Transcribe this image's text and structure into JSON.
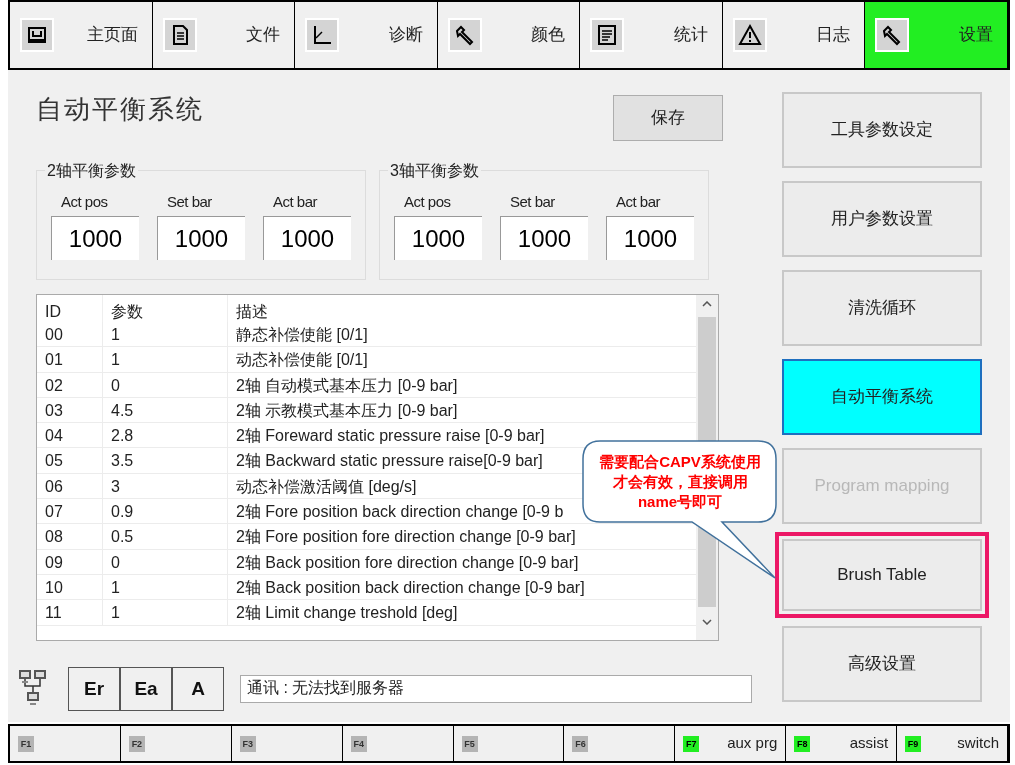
{
  "tabs": [
    {
      "label": "主页面",
      "selected": false
    },
    {
      "label": "文件",
      "selected": false
    },
    {
      "label": "诊断",
      "selected": false
    },
    {
      "label": "颜色",
      "selected": false
    },
    {
      "label": "统计",
      "selected": false
    },
    {
      "label": "日志",
      "selected": false
    },
    {
      "label": "设置",
      "selected": true
    }
  ],
  "page_title": "自动平衡系统",
  "save_button": "保存",
  "groups": [
    {
      "title": "2轴平衡参数",
      "fields": [
        {
          "label": "Act pos",
          "value": "1000"
        },
        {
          "label": "Set bar",
          "value": "1000"
        },
        {
          "label": "Act bar",
          "value": "1000"
        }
      ]
    },
    {
      "title": "3轴平衡参数",
      "fields": [
        {
          "label": "Act pos",
          "value": "1000"
        },
        {
          "label": "Set bar",
          "value": "1000"
        },
        {
          "label": "Act bar",
          "value": "1000"
        }
      ]
    }
  ],
  "table": {
    "columns": [
      "ID",
      "参数",
      "描述"
    ],
    "rows": [
      [
        "00",
        "1",
        "静态补偿使能 [0/1]"
      ],
      [
        "01",
        "1",
        "动态补偿使能 [0/1]"
      ],
      [
        "02",
        "0",
        "2轴 自动模式基本压力 [0-9 bar]"
      ],
      [
        "03",
        "4.5",
        "2轴 示教模式基本压力 [0-9 bar]"
      ],
      [
        "04",
        "2.8",
        "2轴 Foreward static pressure raise [0-9 bar]"
      ],
      [
        "05",
        "3.5",
        "2轴 Backward static pressure raise[0-9 bar]"
      ],
      [
        "06",
        "3",
        "动态补偿激活阈值 [deg/s]"
      ],
      [
        "07",
        "0.9",
        "2轴 Fore position back direction change [0-9 b"
      ],
      [
        "08",
        "0.5",
        "2轴 Fore position fore direction change [0-9 bar]"
      ],
      [
        "09",
        "0",
        "2轴 Back position fore direction change [0-9 bar]"
      ],
      [
        "10",
        "1",
        "2轴 Back position back direction change [0-9 bar]"
      ],
      [
        "11",
        "1",
        "2轴 Limit change treshold [deg]"
      ]
    ]
  },
  "callout": "需要配合CAPV系统使用才会有效，直接调用name号即可",
  "side_buttons": [
    {
      "label": "工具参数设定",
      "selected": false,
      "disabled": false,
      "highlighted": false
    },
    {
      "label": "用户参数设置",
      "selected": false,
      "disabled": false,
      "highlighted": false
    },
    {
      "label": "清洗循环",
      "selected": false,
      "disabled": false,
      "highlighted": false
    },
    {
      "label": "自动平衡系统",
      "selected": true,
      "disabled": false,
      "highlighted": false
    },
    {
      "label": "Program mapping",
      "selected": false,
      "disabled": true,
      "highlighted": false
    },
    {
      "label": "Brush Table",
      "selected": false,
      "disabled": false,
      "highlighted": true
    },
    {
      "label": "高级设置",
      "selected": false,
      "disabled": false,
      "highlighted": false
    }
  ],
  "alarm_buttons": [
    "Er",
    "Ea",
    "A"
  ],
  "status_message": "通讯 : 无法找到服务器",
  "function_keys": [
    {
      "key": "F1",
      "enabled": false
    },
    {
      "key": "F2",
      "enabled": false
    },
    {
      "key": "F3",
      "enabled": false
    },
    {
      "key": "F4",
      "enabled": false
    },
    {
      "key": "F5",
      "enabled": false
    },
    {
      "key": "F6",
      "enabled": false
    },
    {
      "key": "F7",
      "label": "aux prg",
      "enabled": true
    },
    {
      "key": "F8",
      "label": "assist",
      "enabled": true
    },
    {
      "key": "F9",
      "label": "switch",
      "enabled": true
    }
  ]
}
